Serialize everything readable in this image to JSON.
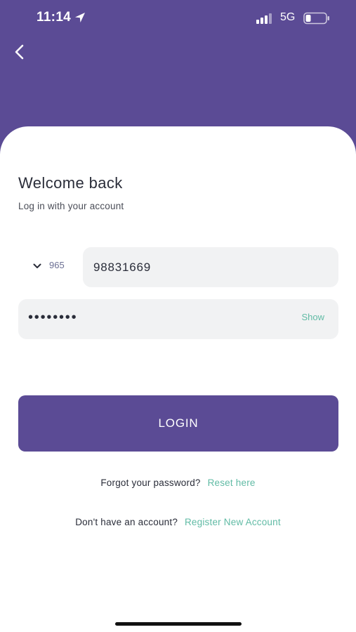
{
  "status_bar": {
    "time": "11:14",
    "network": "5G",
    "location_icon": "location-arrow-icon",
    "signal_icon": "cellular-signal-icon",
    "battery_icon": "battery-low-icon"
  },
  "header": {
    "back_icon": "chevron-left-icon",
    "background_color": "#5b4b95"
  },
  "login": {
    "title": "Welcome back",
    "subtitle": "Log in with your account",
    "country_code": "965",
    "phone_value": "98831669",
    "password_masked": "••••••••",
    "show_label": "Show",
    "login_button_label": "LOGIN",
    "forgot_text": "Forgot your password?",
    "reset_link": "Reset here",
    "no_account_text": "Don't have an account?",
    "register_link": "Register New Account"
  },
  "colors": {
    "brand": "#5b4b95",
    "accent": "#61bba5",
    "field_background": "#f1f2f3"
  }
}
